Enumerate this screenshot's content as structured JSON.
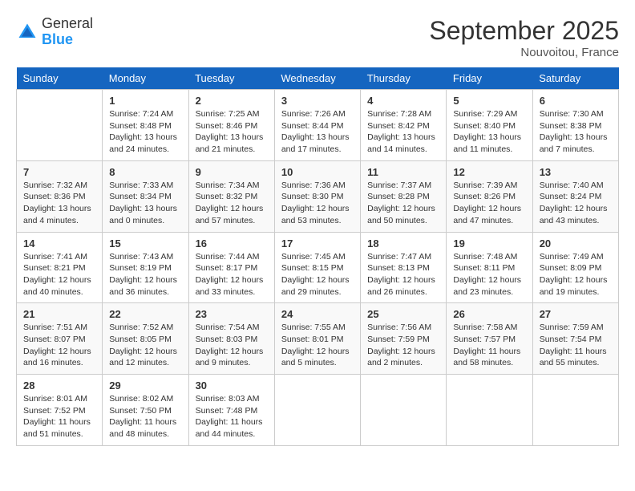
{
  "logo": {
    "general": "General",
    "blue": "Blue"
  },
  "title": "September 2025",
  "location": "Nouvoitou, France",
  "days_header": [
    "Sunday",
    "Monday",
    "Tuesday",
    "Wednesday",
    "Thursday",
    "Friday",
    "Saturday"
  ],
  "weeks": [
    [
      {
        "day": "",
        "sunrise": "",
        "sunset": "",
        "daylight": ""
      },
      {
        "day": "1",
        "sunrise": "Sunrise: 7:24 AM",
        "sunset": "Sunset: 8:48 PM",
        "daylight": "Daylight: 13 hours and 24 minutes."
      },
      {
        "day": "2",
        "sunrise": "Sunrise: 7:25 AM",
        "sunset": "Sunset: 8:46 PM",
        "daylight": "Daylight: 13 hours and 21 minutes."
      },
      {
        "day": "3",
        "sunrise": "Sunrise: 7:26 AM",
        "sunset": "Sunset: 8:44 PM",
        "daylight": "Daylight: 13 hours and 17 minutes."
      },
      {
        "day": "4",
        "sunrise": "Sunrise: 7:28 AM",
        "sunset": "Sunset: 8:42 PM",
        "daylight": "Daylight: 13 hours and 14 minutes."
      },
      {
        "day": "5",
        "sunrise": "Sunrise: 7:29 AM",
        "sunset": "Sunset: 8:40 PM",
        "daylight": "Daylight: 13 hours and 11 minutes."
      },
      {
        "day": "6",
        "sunrise": "Sunrise: 7:30 AM",
        "sunset": "Sunset: 8:38 PM",
        "daylight": "Daylight: 13 hours and 7 minutes."
      }
    ],
    [
      {
        "day": "7",
        "sunrise": "Sunrise: 7:32 AM",
        "sunset": "Sunset: 8:36 PM",
        "daylight": "Daylight: 13 hours and 4 minutes."
      },
      {
        "day": "8",
        "sunrise": "Sunrise: 7:33 AM",
        "sunset": "Sunset: 8:34 PM",
        "daylight": "Daylight: 13 hours and 0 minutes."
      },
      {
        "day": "9",
        "sunrise": "Sunrise: 7:34 AM",
        "sunset": "Sunset: 8:32 PM",
        "daylight": "Daylight: 12 hours and 57 minutes."
      },
      {
        "day": "10",
        "sunrise": "Sunrise: 7:36 AM",
        "sunset": "Sunset: 8:30 PM",
        "daylight": "Daylight: 12 hours and 53 minutes."
      },
      {
        "day": "11",
        "sunrise": "Sunrise: 7:37 AM",
        "sunset": "Sunset: 8:28 PM",
        "daylight": "Daylight: 12 hours and 50 minutes."
      },
      {
        "day": "12",
        "sunrise": "Sunrise: 7:39 AM",
        "sunset": "Sunset: 8:26 PM",
        "daylight": "Daylight: 12 hours and 47 minutes."
      },
      {
        "day": "13",
        "sunrise": "Sunrise: 7:40 AM",
        "sunset": "Sunset: 8:24 PM",
        "daylight": "Daylight: 12 hours and 43 minutes."
      }
    ],
    [
      {
        "day": "14",
        "sunrise": "Sunrise: 7:41 AM",
        "sunset": "Sunset: 8:21 PM",
        "daylight": "Daylight: 12 hours and 40 minutes."
      },
      {
        "day": "15",
        "sunrise": "Sunrise: 7:43 AM",
        "sunset": "Sunset: 8:19 PM",
        "daylight": "Daylight: 12 hours and 36 minutes."
      },
      {
        "day": "16",
        "sunrise": "Sunrise: 7:44 AM",
        "sunset": "Sunset: 8:17 PM",
        "daylight": "Daylight: 12 hours and 33 minutes."
      },
      {
        "day": "17",
        "sunrise": "Sunrise: 7:45 AM",
        "sunset": "Sunset: 8:15 PM",
        "daylight": "Daylight: 12 hours and 29 minutes."
      },
      {
        "day": "18",
        "sunrise": "Sunrise: 7:47 AM",
        "sunset": "Sunset: 8:13 PM",
        "daylight": "Daylight: 12 hours and 26 minutes."
      },
      {
        "day": "19",
        "sunrise": "Sunrise: 7:48 AM",
        "sunset": "Sunset: 8:11 PM",
        "daylight": "Daylight: 12 hours and 23 minutes."
      },
      {
        "day": "20",
        "sunrise": "Sunrise: 7:49 AM",
        "sunset": "Sunset: 8:09 PM",
        "daylight": "Daylight: 12 hours and 19 minutes."
      }
    ],
    [
      {
        "day": "21",
        "sunrise": "Sunrise: 7:51 AM",
        "sunset": "Sunset: 8:07 PM",
        "daylight": "Daylight: 12 hours and 16 minutes."
      },
      {
        "day": "22",
        "sunrise": "Sunrise: 7:52 AM",
        "sunset": "Sunset: 8:05 PM",
        "daylight": "Daylight: 12 hours and 12 minutes."
      },
      {
        "day": "23",
        "sunrise": "Sunrise: 7:54 AM",
        "sunset": "Sunset: 8:03 PM",
        "daylight": "Daylight: 12 hours and 9 minutes."
      },
      {
        "day": "24",
        "sunrise": "Sunrise: 7:55 AM",
        "sunset": "Sunset: 8:01 PM",
        "daylight": "Daylight: 12 hours and 5 minutes."
      },
      {
        "day": "25",
        "sunrise": "Sunrise: 7:56 AM",
        "sunset": "Sunset: 7:59 PM",
        "daylight": "Daylight: 12 hours and 2 minutes."
      },
      {
        "day": "26",
        "sunrise": "Sunrise: 7:58 AM",
        "sunset": "Sunset: 7:57 PM",
        "daylight": "Daylight: 11 hours and 58 minutes."
      },
      {
        "day": "27",
        "sunrise": "Sunrise: 7:59 AM",
        "sunset": "Sunset: 7:54 PM",
        "daylight": "Daylight: 11 hours and 55 minutes."
      }
    ],
    [
      {
        "day": "28",
        "sunrise": "Sunrise: 8:01 AM",
        "sunset": "Sunset: 7:52 PM",
        "daylight": "Daylight: 11 hours and 51 minutes."
      },
      {
        "day": "29",
        "sunrise": "Sunrise: 8:02 AM",
        "sunset": "Sunset: 7:50 PM",
        "daylight": "Daylight: 11 hours and 48 minutes."
      },
      {
        "day": "30",
        "sunrise": "Sunrise: 8:03 AM",
        "sunset": "Sunset: 7:48 PM",
        "daylight": "Daylight: 11 hours and 44 minutes."
      },
      {
        "day": "",
        "sunrise": "",
        "sunset": "",
        "daylight": ""
      },
      {
        "day": "",
        "sunrise": "",
        "sunset": "",
        "daylight": ""
      },
      {
        "day": "",
        "sunrise": "",
        "sunset": "",
        "daylight": ""
      },
      {
        "day": "",
        "sunrise": "",
        "sunset": "",
        "daylight": ""
      }
    ]
  ]
}
